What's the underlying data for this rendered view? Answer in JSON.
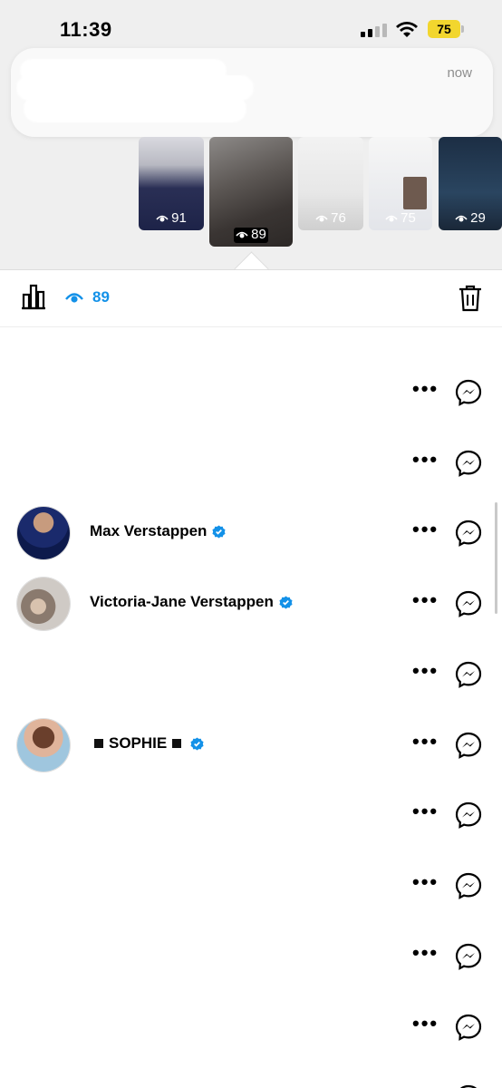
{
  "status_bar": {
    "time": "11:39",
    "battery": "75",
    "battery_color": "#f2d62e"
  },
  "notification": {
    "time": "now"
  },
  "story_thumbnails": [
    {
      "views": "91",
      "selected": false
    },
    {
      "views": "89",
      "selected": true
    },
    {
      "views": "76",
      "selected": false
    },
    {
      "views": "75",
      "selected": false
    },
    {
      "views": "29",
      "selected": false
    }
  ],
  "toolbar": {
    "views_count": "89",
    "accent_color": "#1391e8",
    "icons": [
      "insights-bars-icon",
      "eye-icon",
      "trash-icon"
    ]
  },
  "viewers": [
    {
      "name": "",
      "verified": false,
      "has_avatar": false
    },
    {
      "name": "",
      "verified": false,
      "has_avatar": false
    },
    {
      "name": "Max Verstappen",
      "verified": true,
      "has_avatar": true
    },
    {
      "name": "Victoria-Jane Verstappen",
      "verified": true,
      "has_avatar": true
    },
    {
      "name": "",
      "verified": false,
      "has_avatar": false
    },
    {
      "name": "SOPHIE",
      "verified": true,
      "has_avatar": true
    },
    {
      "name": "",
      "verified": false,
      "has_avatar": false
    },
    {
      "name": "",
      "verified": false,
      "has_avatar": false
    },
    {
      "name": "",
      "verified": false,
      "has_avatar": false
    },
    {
      "name": "",
      "verified": false,
      "has_avatar": false
    }
  ],
  "row_actions": {
    "more_label": "•••",
    "icons": [
      "more-options-icon",
      "messenger-icon"
    ]
  }
}
